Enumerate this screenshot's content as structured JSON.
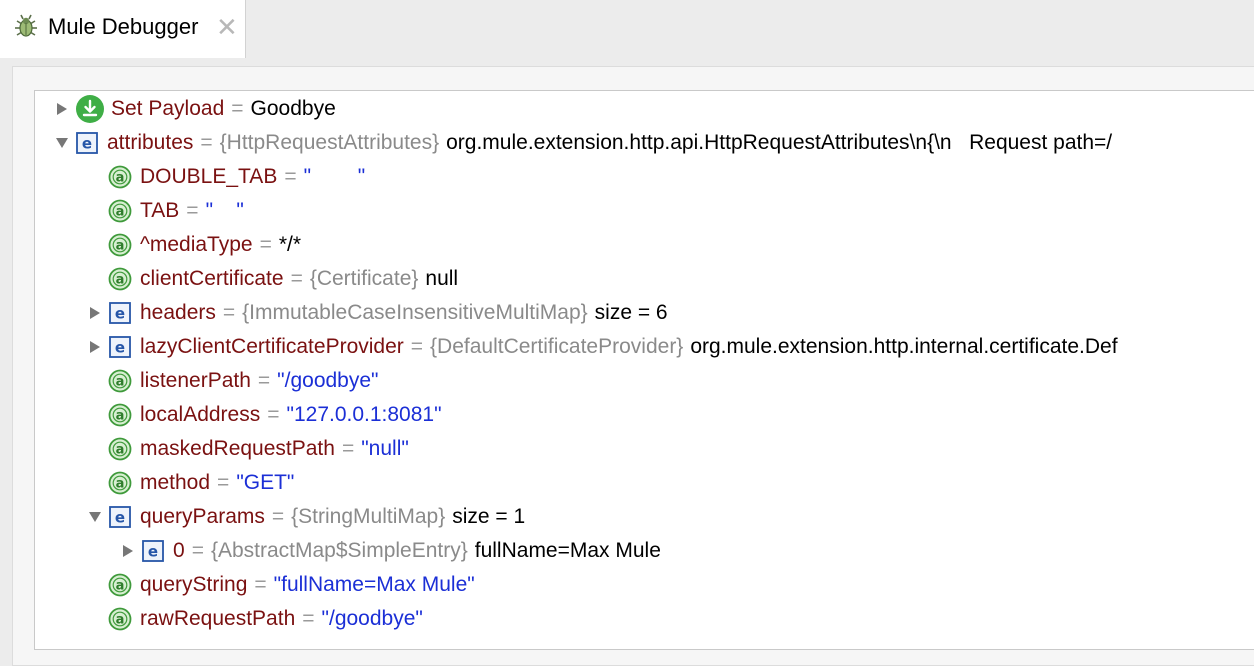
{
  "tab": {
    "title": "Mule Debugger",
    "icon": "bug-icon",
    "close_icon": "close-icon"
  },
  "colors": {
    "name": "#7a1111",
    "string": "#1b2fd6",
    "type": "#8a8a8a",
    "annotation_icon": "#3f9a3b",
    "object_icon": "#2656a8",
    "payload_icon": "#3fae46"
  },
  "rows": [
    {
      "depth": 0,
      "expander": "collapsed",
      "icon": "download-icon",
      "name": "Set Payload",
      "type": "",
      "value": "Goodbye",
      "value_kind": "plain"
    },
    {
      "depth": 0,
      "expander": "expanded",
      "icon": "object-icon",
      "name": "attributes",
      "type": "{HttpRequestAttributes}",
      "value": "org.mule.extension.http.api.HttpRequestAttributes\\n{\\n   Request path=/",
      "value_kind": "plain"
    },
    {
      "depth": 1,
      "expander": "none",
      "icon": "field-icon",
      "name": "DOUBLE_TAB",
      "type": "",
      "value": "\"        \"",
      "value_kind": "string"
    },
    {
      "depth": 1,
      "expander": "none",
      "icon": "field-icon",
      "name": "TAB",
      "type": "",
      "value": "\"    \"",
      "value_kind": "string"
    },
    {
      "depth": 1,
      "expander": "none",
      "icon": "field-icon",
      "name": "^mediaType",
      "type": "",
      "value": "*/*",
      "value_kind": "plain"
    },
    {
      "depth": 1,
      "expander": "none",
      "icon": "field-icon",
      "name": "clientCertificate",
      "type": "{Certificate}",
      "value": "null",
      "value_kind": "plain"
    },
    {
      "depth": 1,
      "expander": "collapsed",
      "icon": "object-icon",
      "name": "headers",
      "type": "{ImmutableCaseInsensitiveMultiMap}",
      "value": "size = 6",
      "value_kind": "plain"
    },
    {
      "depth": 1,
      "expander": "collapsed",
      "icon": "object-icon",
      "name": "lazyClientCertificateProvider",
      "type": "{DefaultCertificateProvider}",
      "value": "org.mule.extension.http.internal.certificate.Def",
      "value_kind": "plain"
    },
    {
      "depth": 1,
      "expander": "none",
      "icon": "field-icon",
      "name": "listenerPath",
      "type": "",
      "value": "\"/goodbye\"",
      "value_kind": "string"
    },
    {
      "depth": 1,
      "expander": "none",
      "icon": "field-icon",
      "name": "localAddress",
      "type": "",
      "value": "\"127.0.0.1:8081\"",
      "value_kind": "string"
    },
    {
      "depth": 1,
      "expander": "none",
      "icon": "field-icon",
      "name": "maskedRequestPath",
      "type": "",
      "value": "\"null\"",
      "value_kind": "string"
    },
    {
      "depth": 1,
      "expander": "none",
      "icon": "field-icon",
      "name": "method",
      "type": "",
      "value": "\"GET\"",
      "value_kind": "string"
    },
    {
      "depth": 1,
      "expander": "expanded",
      "icon": "object-icon",
      "name": "queryParams",
      "type": "{StringMultiMap}",
      "value": "size = 1",
      "value_kind": "plain"
    },
    {
      "depth": 2,
      "expander": "collapsed",
      "icon": "object-icon",
      "name": "0",
      "type": "{AbstractMap$SimpleEntry}",
      "value": "fullName=Max Mule",
      "value_kind": "plain"
    },
    {
      "depth": 1,
      "expander": "none",
      "icon": "field-icon",
      "name": "queryString",
      "type": "",
      "value": "\"fullName=Max Mule\"",
      "value_kind": "string"
    },
    {
      "depth": 1,
      "expander": "none",
      "icon": "field-icon",
      "name": "rawRequestPath",
      "type": "",
      "value": "\"/goodbye\"",
      "value_kind": "string"
    }
  ]
}
